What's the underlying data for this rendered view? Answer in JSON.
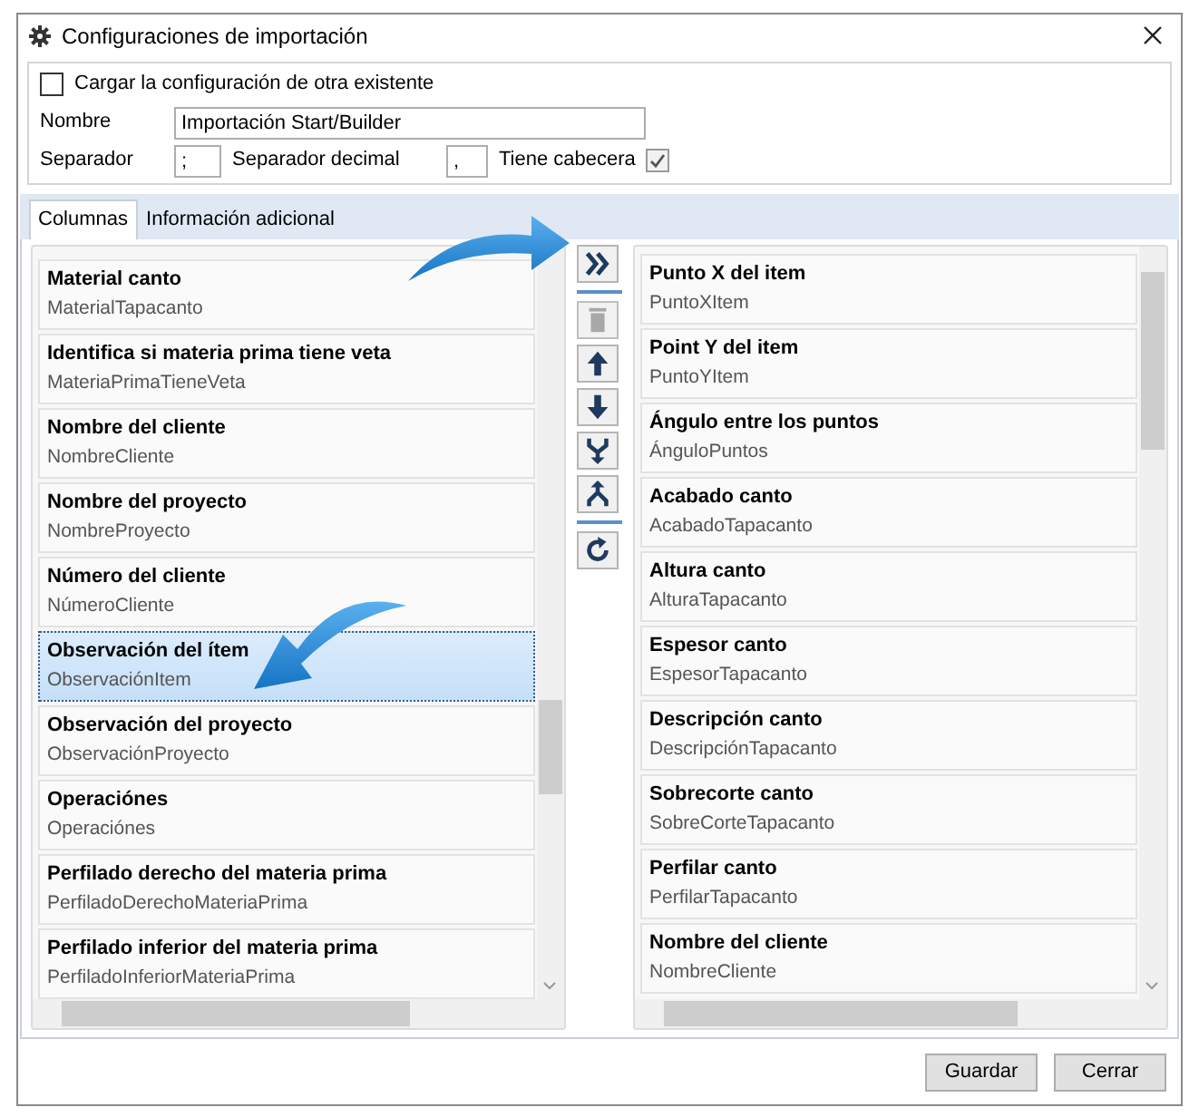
{
  "window": {
    "title": "Configuraciones de importación"
  },
  "load_existing": {
    "label": "Cargar la configuración de otra existente",
    "checked": false
  },
  "name_field": {
    "label": "Nombre",
    "value": "Importación Start/Builder"
  },
  "separator_field": {
    "label": "Separador",
    "value": ";"
  },
  "decimal_field": {
    "label": "Separador decimal",
    "value": ","
  },
  "header_check": {
    "label": "Tiene cabecera",
    "checked": true
  },
  "tabs": [
    {
      "label": "Columnas",
      "selected": true
    },
    {
      "label": "Información adicional",
      "selected": false
    }
  ],
  "available_columns": [
    {
      "title": "Material canto",
      "field": "MaterialTapacanto",
      "selected": false
    },
    {
      "title": "Identifica si materia prima tiene veta",
      "field": "MateriaPrimaTieneVeta",
      "selected": false
    },
    {
      "title": "Nombre del cliente",
      "field": "NombreCliente",
      "selected": false
    },
    {
      "title": "Nombre del proyecto",
      "field": "NombreProyecto",
      "selected": false
    },
    {
      "title": "Número del cliente",
      "field": "NúmeroCliente",
      "selected": false
    },
    {
      "title": "Observación del ítem",
      "field": "ObservaciónItem",
      "selected": true
    },
    {
      "title": "Observación del proyecto",
      "field": "ObservaciónProyecto",
      "selected": false
    },
    {
      "title": "Operaciónes",
      "field": "Operaciónes",
      "selected": false
    },
    {
      "title": "Perfilado derecho del materia prima",
      "field": "PerfiladoDerechoMateriaPrima",
      "selected": false
    },
    {
      "title": "Perfilado inferior del materia prima",
      "field": "PerfiladoInferiorMateriaPrima",
      "selected": false
    }
  ],
  "toolbar": [
    {
      "kind": "add",
      "disabled": false
    },
    {
      "kind": "sep"
    },
    {
      "kind": "delete",
      "disabled": true
    },
    {
      "kind": "up",
      "disabled": false
    },
    {
      "kind": "down",
      "disabled": false
    },
    {
      "kind": "merge",
      "disabled": false
    },
    {
      "kind": "split",
      "disabled": false
    },
    {
      "kind": "sep"
    },
    {
      "kind": "reload",
      "disabled": false
    }
  ],
  "selected_columns": [
    {
      "title": "Punto X del item",
      "field": "PuntoXItem",
      "selected": false
    },
    {
      "title": "Point Y del item",
      "field": "PuntoYItem",
      "selected": false
    },
    {
      "title": "Ángulo entre los puntos",
      "field": "ÁnguloPuntos",
      "selected": false
    },
    {
      "title": "Acabado canto",
      "field": "AcabadoTapacanto",
      "selected": false
    },
    {
      "title": "Altura canto",
      "field": "AlturaTapacanto",
      "selected": false
    },
    {
      "title": "Espesor canto",
      "field": "EspesorTapacanto",
      "selected": false
    },
    {
      "title": "Descripción canto",
      "field": "DescripciónTapacanto",
      "selected": false
    },
    {
      "title": "Sobrecorte canto",
      "field": "SobreCorteTapacanto",
      "selected": false
    },
    {
      "title": "Perfilar canto",
      "field": "PerfilarTapacanto",
      "selected": false
    },
    {
      "title": "Nombre del cliente",
      "field": "NombreCliente",
      "selected": false
    }
  ],
  "buttons": [
    "Guardar",
    "Cerrar"
  ]
}
